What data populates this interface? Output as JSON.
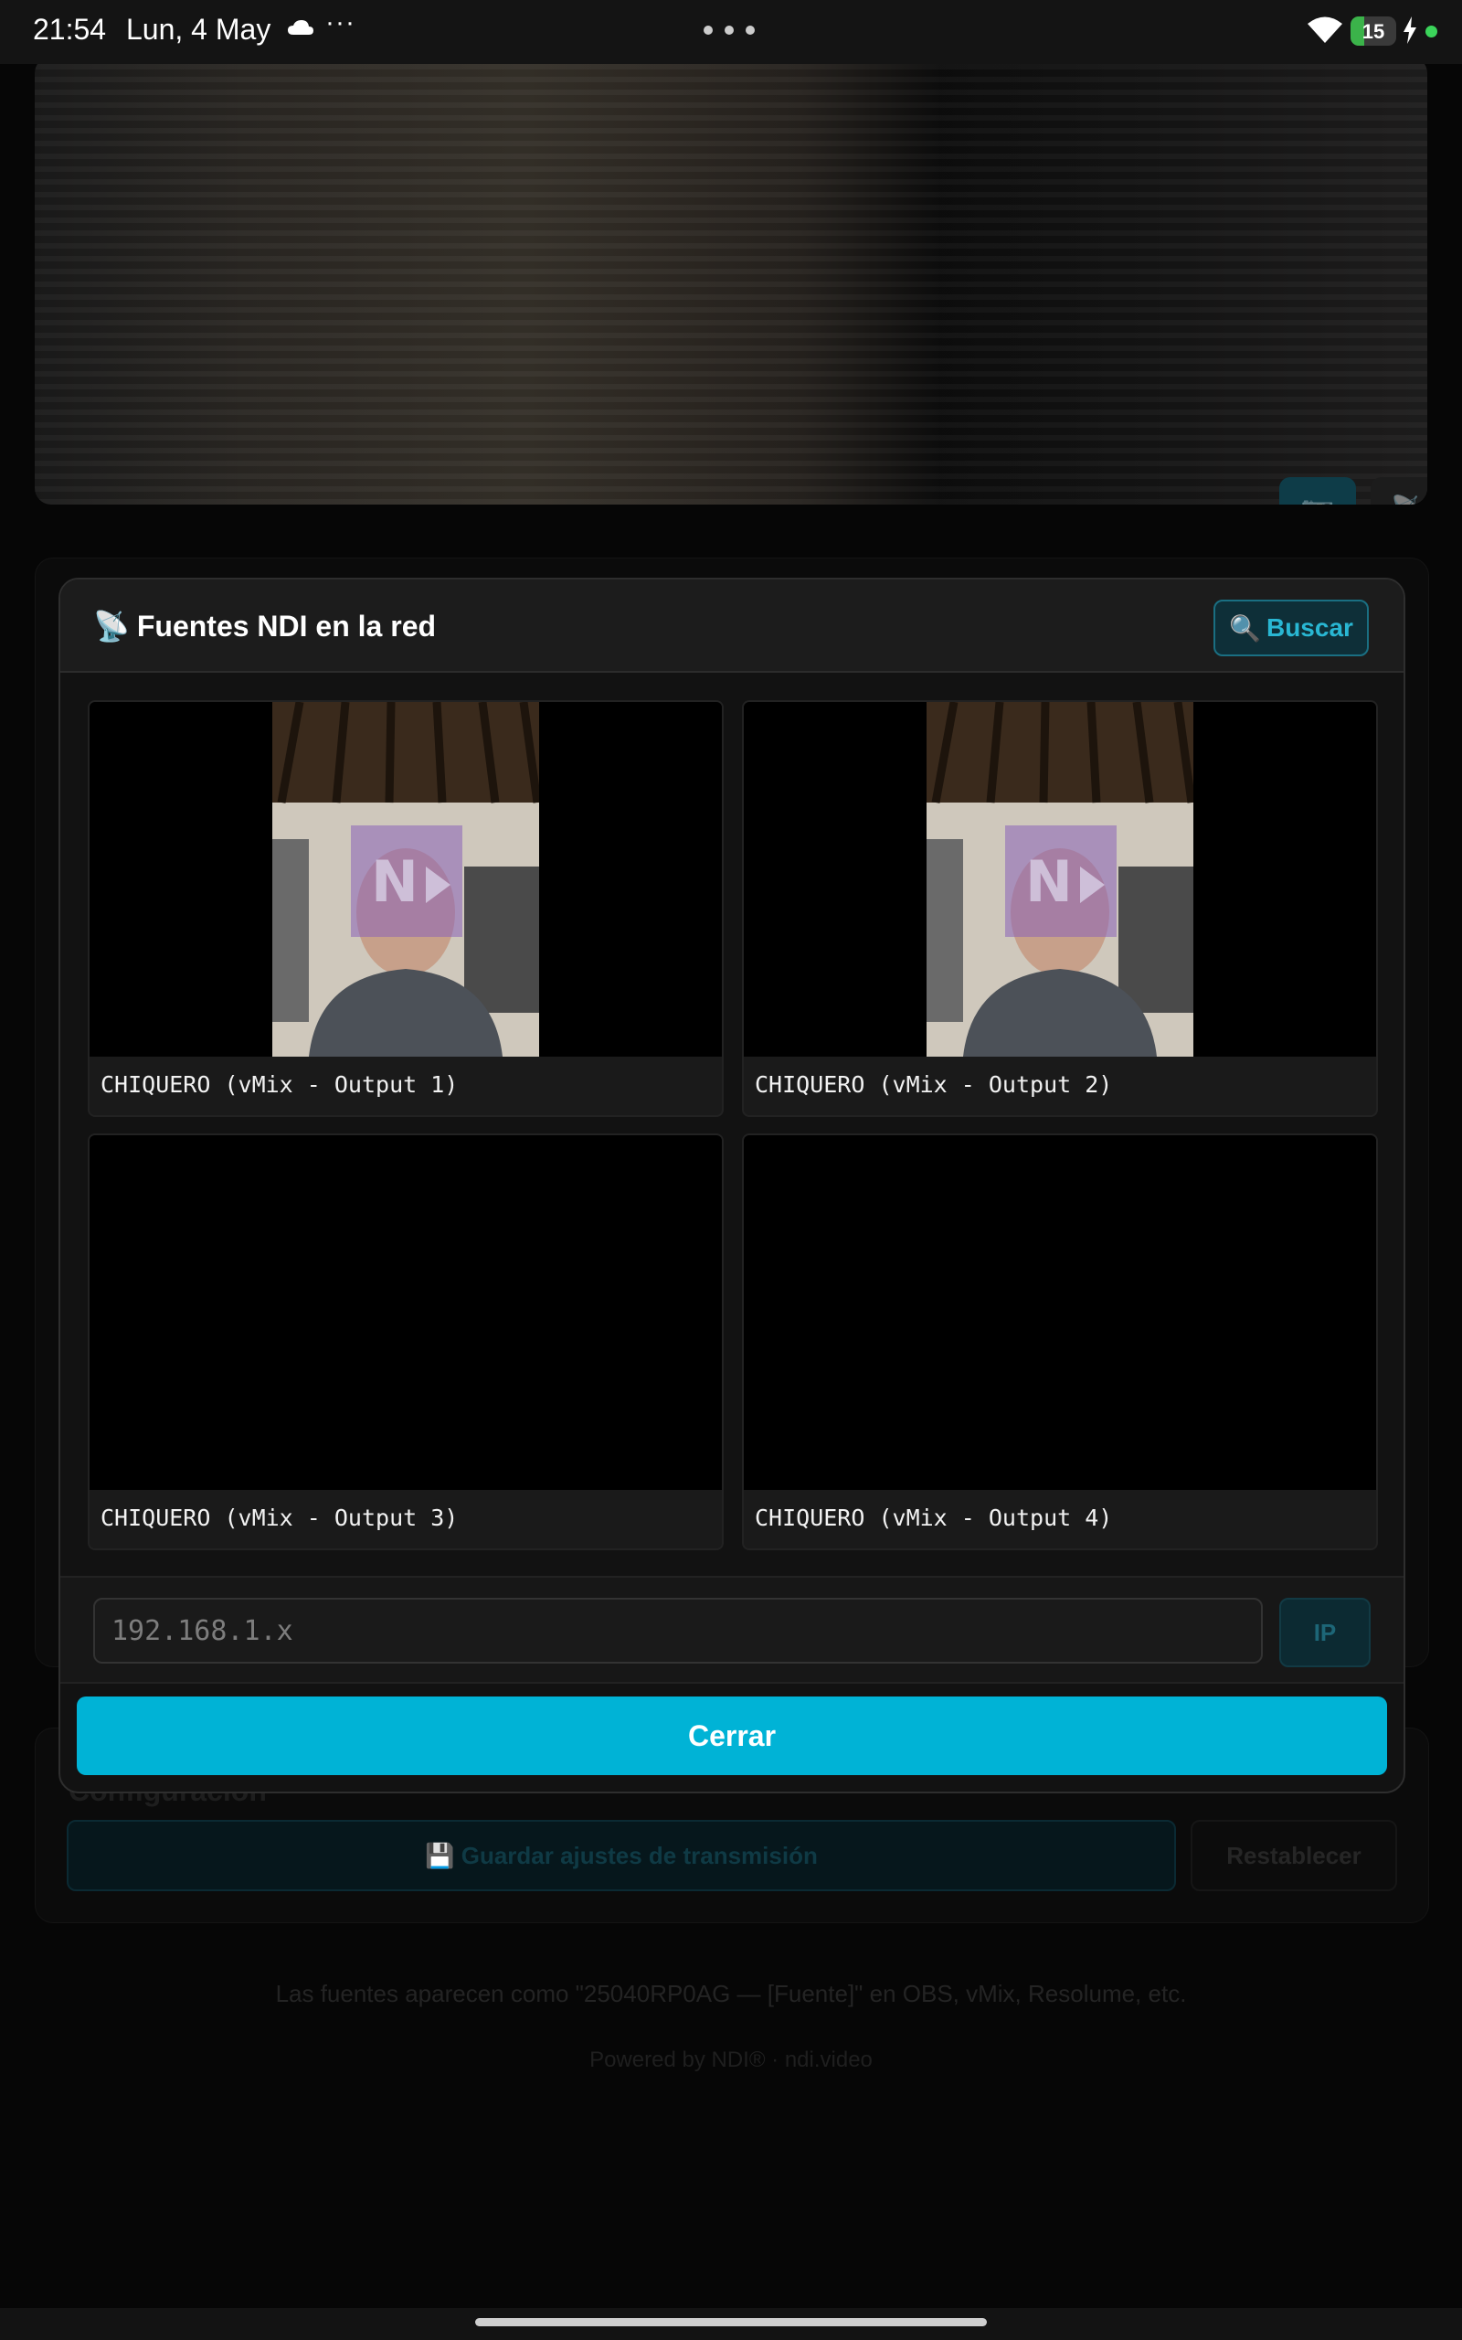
{
  "status_bar": {
    "time": "21:54",
    "date": "Lun, 4 May",
    "more_left": "···",
    "battery": "15",
    "battery_level_percent": 15
  },
  "background": {
    "camera_button_icon": "camera-icon",
    "ndi_button_icon": "satellite-antenna-icon",
    "config_title": "Configuración",
    "save_button": "💾 Guardar ajustes de transmisión",
    "reset_button": "Restablecer",
    "footer_note": "Las fuentes aparecen como \"25040RP0AG — [Fuente]\" en OBS, vMix, Resolume, etc.",
    "footer_powered": "Powered by NDI®  ·  ndi.video"
  },
  "modal": {
    "title_icon": "📡",
    "title": "Fuentes NDI en la red",
    "search_icon": "🔍",
    "search_label": "Buscar",
    "sources": [
      {
        "label": "CHIQUERO (vMix - Output 1)",
        "has_preview": true
      },
      {
        "label": "CHIQUERO (vMix - Output 2)",
        "has_preview": true
      },
      {
        "label": "CHIQUERO (vMix - Output 3)",
        "has_preview": false
      },
      {
        "label": "CHIQUERO (vMix - Output 4)",
        "has_preview": false
      }
    ],
    "ip_placeholder": "192.168.1.x",
    "ip_button": "IP",
    "close_button": "Cerrar"
  },
  "colors": {
    "accent": "#00b3d6",
    "background": "#060606",
    "modal": "#121212"
  }
}
